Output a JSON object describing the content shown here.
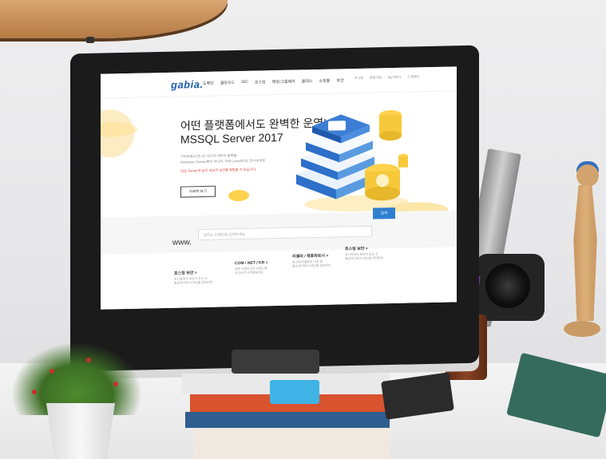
{
  "site": {
    "logo": "gabia.",
    "menu": [
      "도메인",
      "클라우드",
      "IDC",
      "호스팅",
      "메일/그룹웨어",
      "클래스",
      "쇼핑몰",
      "보안"
    ],
    "util": [
      "로그인",
      "회원가입",
      "My가비아",
      "고객센터"
    ]
  },
  "hero": {
    "title_line1": "어떤 플랫폼에서도 완벽한 운영!",
    "title_line2": "MSSQL Server 2017",
    "desc_line1": "가비아에서 만나는 최신의 데이터 플랫폼!",
    "desc_line2": "Windows, Docker뿐만 아니라, 이제 Linux에서도 만나보세요.",
    "note": "SQL Server의 높은 성능과 보안을 경험할 수 있습니다.",
    "button": "자세히 보기"
  },
  "search": {
    "prefix": "www.",
    "placeholder": "원하는 도메인을 입력하세요",
    "button": "검색"
  },
  "info_columns": [
    {
      "title": "호스팅 보안 >",
      "desc": "호스팅에서 보안이 있는 것\n필요에 따라서 보안을 업데이트"
    },
    {
      "title": "COM / NET / KR >",
      "desc": "대표 도메인으로 브랜드를\n이것으로 시작해보세요"
    },
    {
      "title": "리셀러 / 제휴파트너 >",
      "desc": "호스팅/리셀링과 이전 등\n필요에 따라서 보안을 업데이트"
    },
    {
      "title": "호스팅 보안 >",
      "desc": "호스팅에서 보안이 있는 것\n필요에 따라서 보안을 업데이트"
    }
  ],
  "colors": {
    "brand_blue": "#1e5fae",
    "button_blue": "#2f7fd1",
    "accent_yellow": "#ffd24d",
    "note_red": "#e0473a"
  }
}
